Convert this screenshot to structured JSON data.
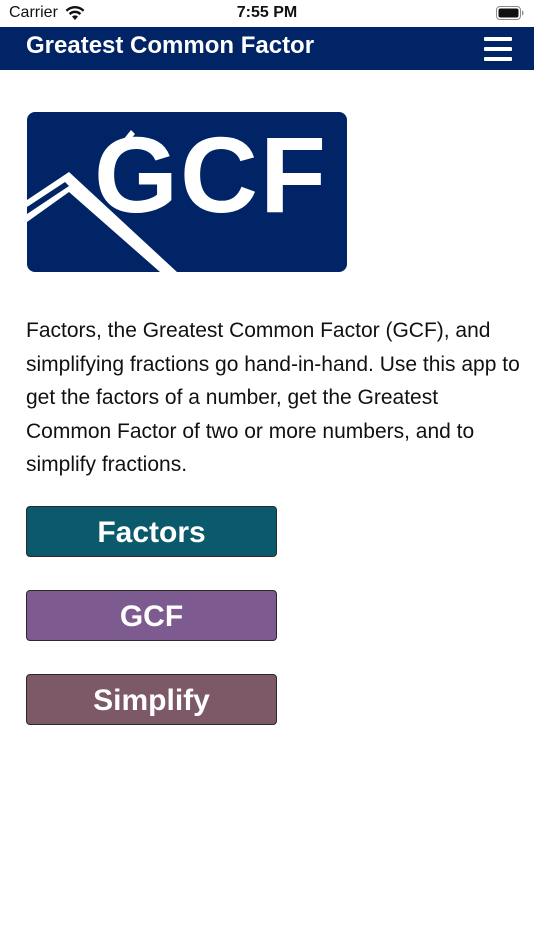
{
  "status_bar": {
    "carrier": "Carrier",
    "time": "7:55 PM"
  },
  "nav": {
    "title": "Greatest Common Factor",
    "menu_icon": "hamburger-menu-icon",
    "background": "#012466"
  },
  "logo": {
    "text": "GCF",
    "background": "#012466"
  },
  "description": "Factors, the Greatest Common Factor (GCF), and simplifying fractions go hand-in-hand. Use this app to get the factors of a number, get the Greatest Common Factor of two or more numbers, and to simplify fractions.",
  "buttons": {
    "factors": {
      "label": "Factors",
      "color": "#0b5a6b"
    },
    "gcf": {
      "label": "GCF",
      "color": "#7d5a8f"
    },
    "simplify": {
      "label": "Simplify",
      "color": "#7d5866"
    }
  }
}
